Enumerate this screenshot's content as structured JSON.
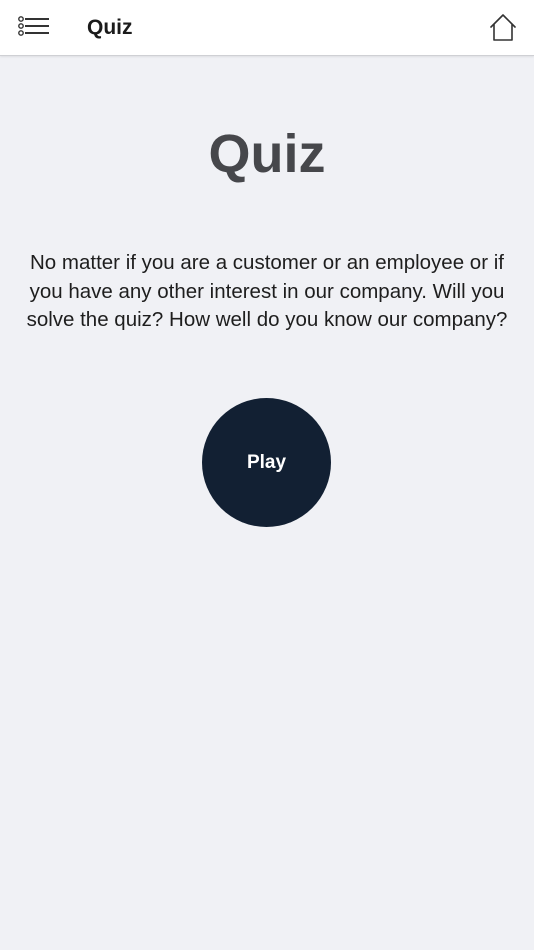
{
  "header": {
    "title": "Quiz",
    "menu_icon": "list-menu-icon",
    "home_icon": "home-icon"
  },
  "main": {
    "heading": "Quiz",
    "intro": "No matter if you are a customer or an employee or if you have any other interest in our company. Will you solve the quiz? How well do you know our company?",
    "play_label": "Play"
  },
  "colors": {
    "background": "#f0f1f5",
    "header_bg": "#ffffff",
    "heading_text": "#46474b",
    "play_button": "#122033",
    "play_text": "#ffffff"
  }
}
